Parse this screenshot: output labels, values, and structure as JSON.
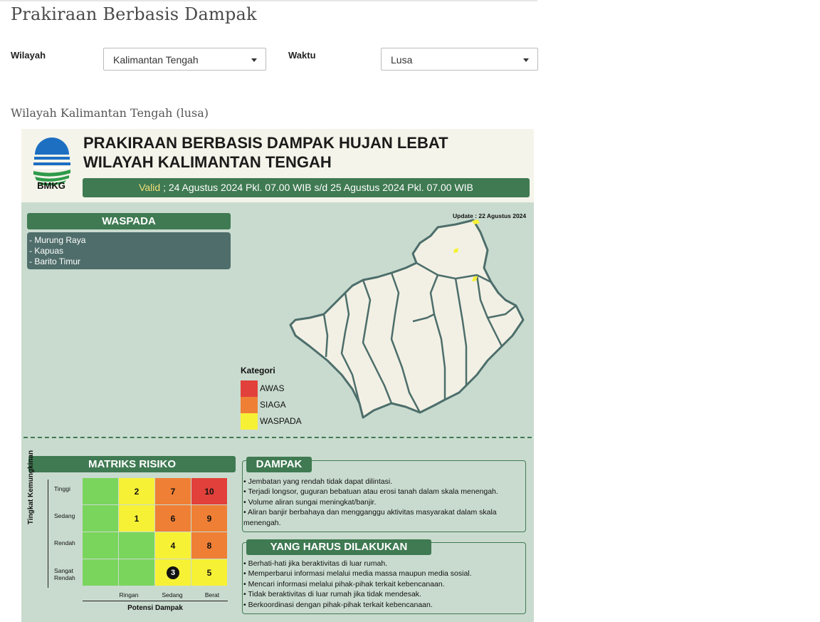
{
  "page": {
    "title": "Prakiraan Berbasis Dampak",
    "subtitle": "Wilayah Kalimantan Tengah (lusa)"
  },
  "filters": {
    "region_label": "Wilayah",
    "region_value": "Kalimantan Tengah",
    "time_label": "Waktu",
    "time_value": "Lusa"
  },
  "infographic": {
    "logo_text": "BMKG",
    "title_line1": "PRAKIRAAN BERBASIS DAMPAK HUJAN LEBAT",
    "title_line2": "WILAYAH KALIMANTAN TENGAH",
    "valid_key": "Valid",
    "valid_text": " ; 24 Agustus 2024 Pkl. 07.00 WIB s/d 25 Agustus 2024 Pkl. 07.00 WIB",
    "update_text": "Update : 22 Agustus 2024",
    "warning_title": "WASPADA",
    "warning_areas": [
      "- Murung Raya",
      "- Kapuas",
      "- Barito Timur"
    ],
    "legend_title": "Kategori",
    "legend": [
      {
        "label": "AWAS",
        "color": "#e2403a"
      },
      {
        "label": "SIAGA",
        "color": "#ef7f35"
      },
      {
        "label": "WASPADA",
        "color": "#f7f135"
      }
    ],
    "matrix": {
      "title": "MATRIKS RISIKO",
      "y_axis_label": "Tingkat Kemungkinan",
      "x_axis_label": "Potensi Dampak",
      "rows": [
        "Tinggi",
        "Sedang",
        "Rendah",
        "Sangat Rendah"
      ],
      "columns": [
        "Ringan",
        "Sedang",
        "Berat"
      ],
      "cells": [
        {
          "text": "",
          "color": "#7ad55c"
        },
        {
          "text": "2",
          "color": "#f7f135"
        },
        {
          "text": "7",
          "color": "#ef7f35"
        },
        {
          "text": "10",
          "color": "#e2403a"
        },
        {
          "text": "",
          "color": "#7ad55c"
        },
        {
          "text": "1",
          "color": "#f7f135"
        },
        {
          "text": "6",
          "color": "#ef7f35"
        },
        {
          "text": "9",
          "color": "#ef7f35"
        },
        {
          "text": "",
          "color": "#7ad55c"
        },
        {
          "text": "",
          "color": "#7ad55c"
        },
        {
          "text": "4",
          "color": "#f7f135"
        },
        {
          "text": "8",
          "color": "#ef7f35"
        },
        {
          "text": "",
          "color": "#7ad55c"
        },
        {
          "text": "",
          "color": "#7ad55c"
        },
        {
          "text": "3",
          "color": "#f7f135",
          "selected": true
        },
        {
          "text": "5",
          "color": "#f7f135"
        }
      ]
    },
    "impact": {
      "title": "DAMPAK",
      "lines": [
        "• Jembatan yang rendah tidak dapat dilintasi.",
        "• Terjadi longsor, guguran bebatuan atau erosi tanah dalam skala menengah.",
        "• Volume aliran sungai meningkat/banjir.",
        "• Aliran banjir berbahaya dan mengganggu aktivitas masyarakat dalam skala",
        "menengah."
      ]
    },
    "actions": {
      "title": "YANG HARUS DILAKUKAN",
      "lines": [
        "• Berhati-hati jika beraktivitas di luar rumah.",
        "• Memperbarui informasi melalui media massa maupun media sosial.",
        "• Mencari informasi melalui pihak-pihak terkait kebencanaan.",
        "• Tidak beraktivitas di luar rumah jika tidak mendesak.",
        "• Berkoordinasi dengan pihak-pihak terkait kebencanaan."
      ]
    }
  }
}
